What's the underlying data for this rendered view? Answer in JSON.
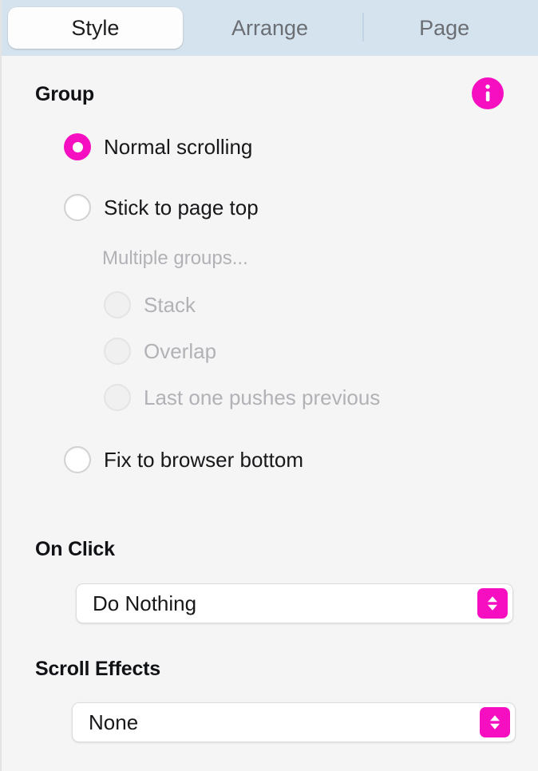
{
  "tabs": [
    {
      "label": "Style",
      "selected": true
    },
    {
      "label": "Arrange",
      "selected": false
    },
    {
      "label": "Page",
      "selected": false
    }
  ],
  "group_section": {
    "heading": "Group",
    "info_icon": "info-circle-icon",
    "options": [
      {
        "label": "Normal scrolling",
        "state": "checked"
      },
      {
        "label": "Stick to page top",
        "state": "unchecked"
      }
    ],
    "sub_note": "Multiple groups...",
    "nested_options": [
      {
        "label": "Stack",
        "state": "disabled"
      },
      {
        "label": "Overlap",
        "state": "disabled"
      },
      {
        "label": "Last one pushes previous",
        "state": "disabled"
      }
    ],
    "last_option": {
      "label": "Fix to browser bottom",
      "state": "unchecked"
    }
  },
  "on_click_section": {
    "heading": "On Click",
    "select_value": "Do Nothing",
    "stepper_icon": "up-down-chevron-icon"
  },
  "scroll_effects_section": {
    "heading": "Scroll Effects",
    "select_value": "None",
    "stepper_icon": "up-down-chevron-icon"
  },
  "colors": {
    "accent": "#f50fc0",
    "tabbar_background": "#d5e3ef",
    "panel_background": "#f5f5f6",
    "text": "#18181a",
    "disabled_text": "#b2b2b6"
  }
}
